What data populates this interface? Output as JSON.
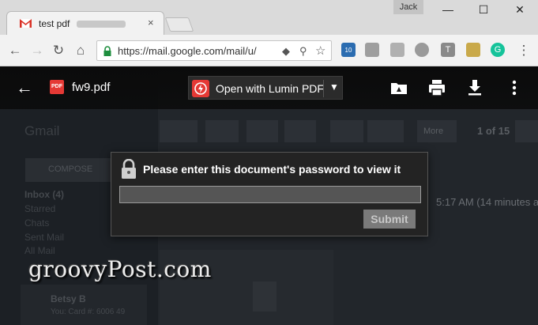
{
  "browser": {
    "tab_title": "test pdf",
    "tab_close": "×",
    "user": "Jack",
    "minimize": "—",
    "maximize": "☐",
    "close": "✕",
    "url": "https://mail.google.com/mail/u/",
    "back": "←",
    "forward": "→",
    "reload": "↻",
    "home": "⌂",
    "menu": "⋮",
    "ext_badge": "10"
  },
  "gmail_bg": {
    "logo": "Gmail",
    "compose": "COMPOSE",
    "inbox": "Inbox (4)",
    "starred": "Starred",
    "chats": "Chats",
    "sent": "Sent Mail",
    "all": "All Mail",
    "more": "More",
    "pager": "1 of 15",
    "time": "5:17 AM (14 minutes a",
    "contact_name": "Betsy B",
    "contact_sub": "You: Card #: 6006 49"
  },
  "viewer": {
    "back": "←",
    "pdf_badge": "PDF",
    "file_name": "fw9.pdf",
    "open_with": "Open with Lumin PDF",
    "dropdown": "▼"
  },
  "dialog": {
    "message": "Please enter this document's password to view it",
    "password_value": "",
    "submit": "Submit"
  },
  "watermark": "groovyPost.com"
}
